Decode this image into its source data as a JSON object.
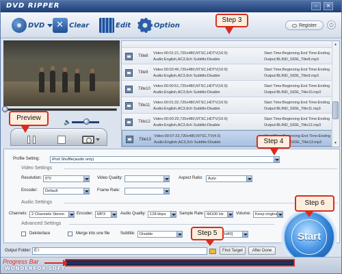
{
  "app": {
    "title": "DVD RIPPER",
    "brand": "WONDERFOX SOFT"
  },
  "window": {
    "min": "–",
    "close": "✕"
  },
  "toolbar": {
    "dvd_label": "DVD",
    "clear_label": "Clear",
    "edit_label": "Edit",
    "option_label": "Option",
    "register_label": "Register"
  },
  "titles": [
    {
      "name": "Title8",
      "video": "Video:00:01:21,720x480,NTSC,HDTV(16:9)",
      "audio": "Audio:English,AC3,6ch Subtitle:Disable",
      "start": "Start Time:Beginning End Time:Ending",
      "output": "Output:BLIND_SIDE_Title8.mp3",
      "selected": false
    },
    {
      "name": "Title9",
      "video": "Video:00:03:46,720x480,NTSC,HDTV(16:9)",
      "audio": "Audio:English,AC3,6ch Subtitle:Disable",
      "start": "Start Time:Beginning End Time:Ending",
      "output": "Output:BLIND_SIDE_Title9.mp3",
      "selected": false
    },
    {
      "name": "Title10",
      "video": "Video:00:00:51,720x480,NTSC,HDTV(16:9)",
      "audio": "Audio:English,AC3,6ch Subtitle:Disable",
      "start": "Start Time:Beginning End Time:Ending",
      "output": "Output:BLIND_SIDE_Title10.mp3",
      "selected": false
    },
    {
      "name": "Title11",
      "video": "Video:00:01:32,720x480,NTSC,HDTV(16:9)",
      "audio": "Audio:English,AC3,6ch Subtitle:Disable",
      "start": "Start Time:Beginning End Time:Ending",
      "output": "Output:BLIND_SIDE_Title11.mp3",
      "selected": false
    },
    {
      "name": "Title12",
      "video": "Video:00:00:29,720x480,NTSC,HDTV(16:9)",
      "audio": "Audio:English,AC3,6ch Subtitle:Disable",
      "start": "Start Time:Beginning End Time:Ending",
      "output": "Output:BLIND_SIDE_Title12.mp3",
      "selected": false
    },
    {
      "name": "Title13",
      "video": "Video:00:07:23,720x480,NTSC,TV(4:3)",
      "audio": "Audio:English,AC3,2ch Subtitle:Disable",
      "start": "Start Time:Beginning End Time:Ending",
      "output": "Output:BLIND_SIDE_Title13.mp3",
      "selected": true
    }
  ],
  "profile": {
    "label": "Profile Setting:",
    "value": "iPod Shuffle(audio only)"
  },
  "video_settings": {
    "header": "Video Settings",
    "resolution_label": "Resolution:",
    "resolution_value": "0*0",
    "quality_label": "Video Quality:",
    "quality_value": "",
    "aspect_label": "Aspect Ratio:",
    "aspect_value": "Auto",
    "encoder_label": "Encoder:",
    "encoder_value": "Default",
    "framerate_label": "Frame Rate:",
    "framerate_value": ""
  },
  "audio_settings": {
    "header": "Audio Settings",
    "channels_label": "Channels:",
    "channels_value": "2 Channels Stereo",
    "encoder_label": "Encoder:",
    "encoder_value": "MP3",
    "quality_label": "Audio Quality:",
    "quality_value": "128 kbps",
    "samplerate_label": "Sample Rate:",
    "samplerate_value": "44100 Hz",
    "volume_label": "Volume:",
    "volume_value": "Keep origina"
  },
  "advanced_settings": {
    "header": "Advanced Settings",
    "deinterlace_label": "Deinterlace",
    "merge_label": "Merge into one file",
    "subtitle_label": "Subtitle:",
    "subtitle_value": "Disable",
    "size_value": "0x80]"
  },
  "output": {
    "folder_label": "Output Folder:",
    "folder_value": "E:\\",
    "find_target": "Find Target",
    "after_done": "After Done"
  },
  "start_label": "Start",
  "callouts": {
    "step3": "Step 3",
    "step4": "Step 4",
    "step5": "Step 5",
    "step6": "Step 6",
    "preview": "Preview",
    "progress_bar": "Progress Bar"
  },
  "colors": {
    "accent": "#1d4f94",
    "callout_border": "#d92b20",
    "callout_fill": "#fdeedd",
    "selected_row": "#a9c0e2"
  }
}
